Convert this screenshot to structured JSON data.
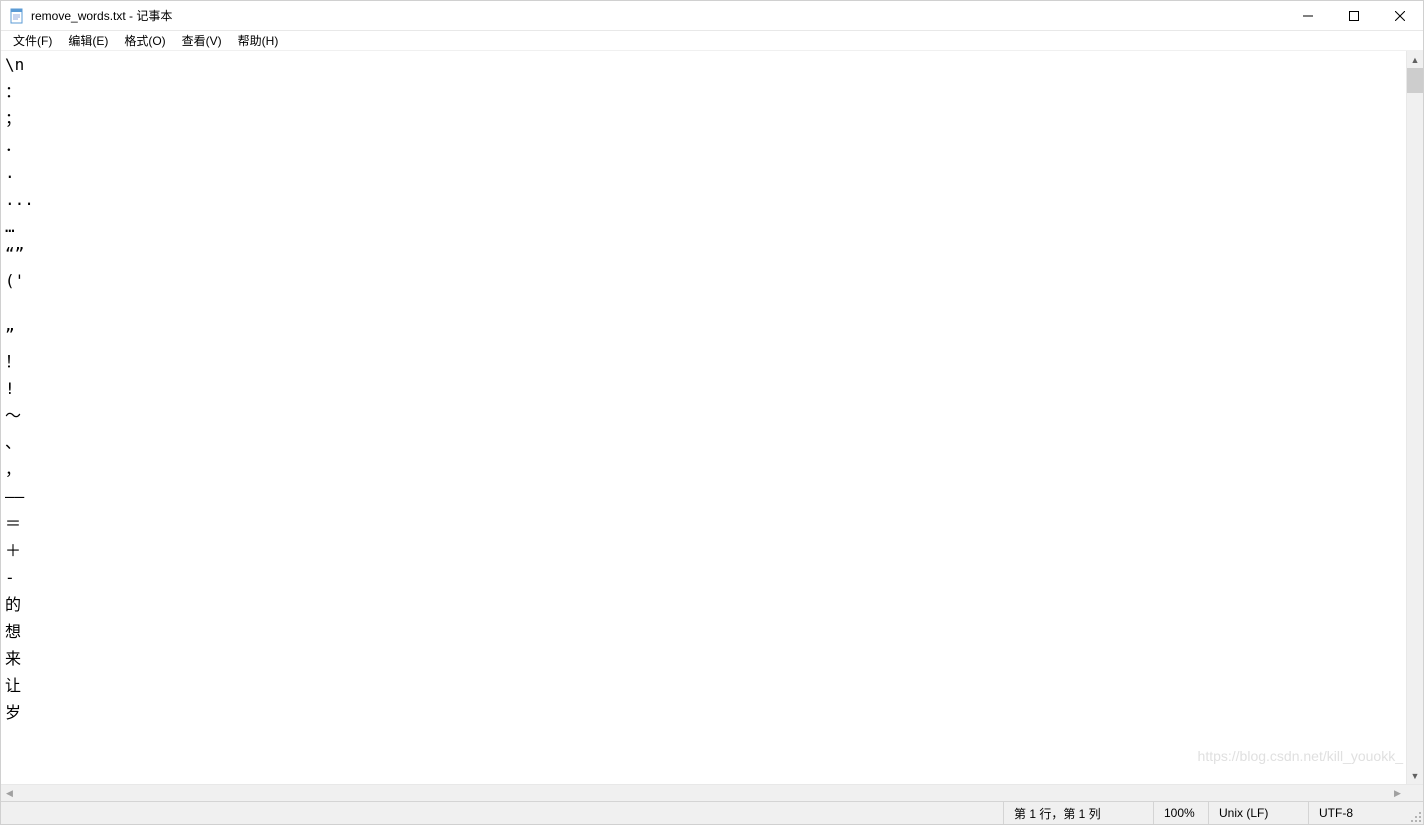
{
  "titlebar": {
    "title": "remove_words.txt - 记事本"
  },
  "menubar": {
    "file": "文件(F)",
    "edit": "编辑(E)",
    "format": "格式(O)",
    "view": "查看(V)",
    "help": "帮助(H)"
  },
  "content": {
    "text": "\\n\n：\n；\n．\n.\n...\n…\n“”\n('\n\n”\n！\n!\n～\n、\n，\n——\n＝\n＋\n-\n的\n想\n来\n让\n岁"
  },
  "statusbar": {
    "position": "第 1 行，第 1 列",
    "zoom": "100%",
    "eol": "Unix (LF)",
    "encoding": "UTF-8"
  },
  "watermark": "https://blog.csdn.net/kill_youokk_"
}
